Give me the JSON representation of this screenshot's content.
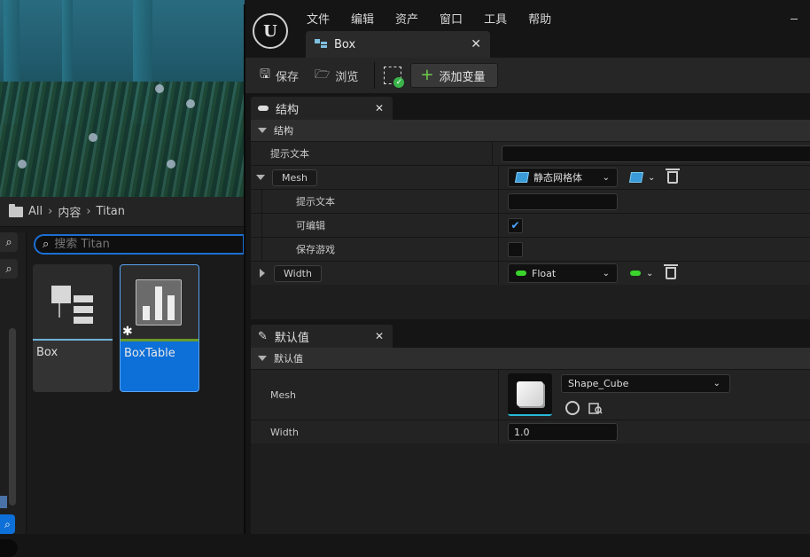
{
  "content_browser": {
    "path": [
      "All",
      "内容",
      "Titan"
    ],
    "search_placeholder": "搜索 Titan",
    "assets": [
      {
        "label": "Box",
        "kind": "struct"
      },
      {
        "label": "BoxTable",
        "kind": "data-table",
        "selected": true
      }
    ]
  },
  "editor": {
    "menu": [
      "文件",
      "编辑",
      "资产",
      "窗口",
      "工具",
      "帮助"
    ],
    "tab_title": "Box",
    "toolbar": {
      "save_label": "保存",
      "browse_label": "浏览",
      "add_variable_label": "添加变量"
    },
    "structure_panel": {
      "tab_label": "结构",
      "section_label": "结构",
      "tooltip_label": "提示文本",
      "tooltip_value": "",
      "variables": [
        {
          "name": "Mesh",
          "type_label": "静态网格体",
          "type_color": "#3a9bd9",
          "props": {
            "tooltip_label": "提示文本",
            "tooltip_value": "",
            "editable_label": "可编辑",
            "editable_checked": true,
            "savegame_label": "保存游戏",
            "savegame_checked": false
          }
        },
        {
          "name": "Width",
          "type_label": "Float",
          "type_color": "#39d42c"
        }
      ]
    },
    "defaults_panel": {
      "tab_label": "默认值",
      "section_label": "默认值",
      "mesh_label": "Mesh",
      "mesh_value": "Shape_Cube",
      "width_label": "Width",
      "width_value": "1.0"
    }
  },
  "colors": {
    "accent_blue": "#0d6fd8",
    "float_green": "#39d42c",
    "mesh_blue": "#3a9bd9"
  }
}
